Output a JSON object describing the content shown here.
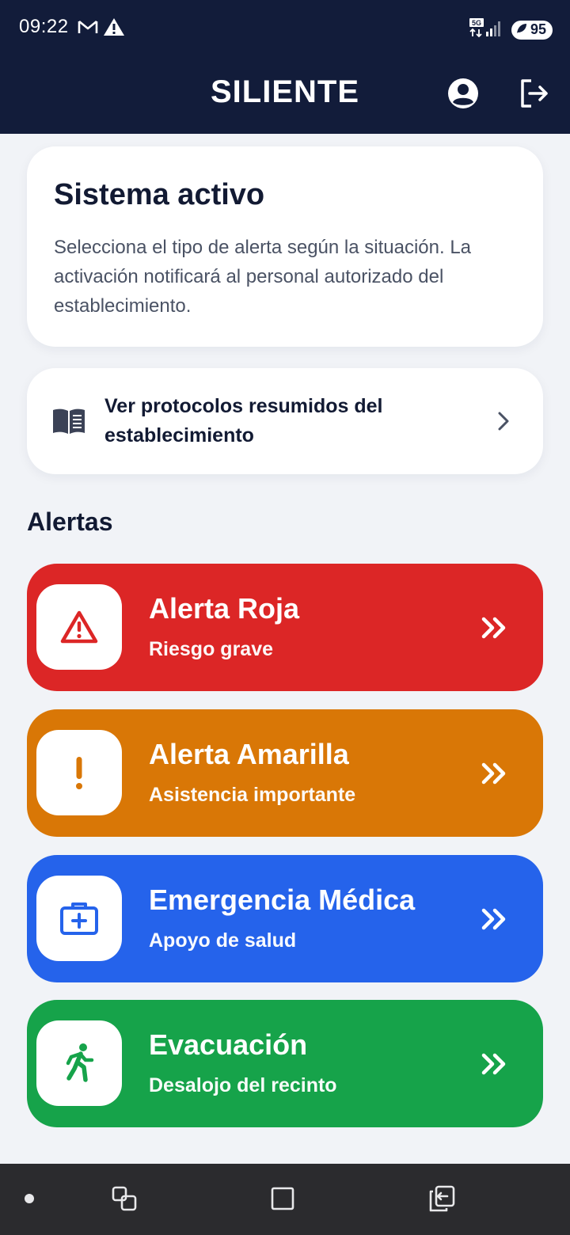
{
  "status_bar": {
    "time": "09:22",
    "left_icons": [
      "gmail-icon",
      "warning-icon"
    ],
    "network": "5G",
    "battery": "95"
  },
  "header": {
    "title": "SILIENTE",
    "profile_icon": "account-circle-icon",
    "logout_icon": "logout-icon"
  },
  "status_card": {
    "title": "Sistema activo",
    "description": "Selecciona el tipo de alerta según la situación. La activación notificará al personal autorizado del establecimiento."
  },
  "protocol_card": {
    "label": "Ver protocolos resumidos del establecimiento",
    "icon": "book-icon"
  },
  "section": {
    "title": "Alertas"
  },
  "alerts": [
    {
      "title": "Alerta Roja",
      "subtitle": "Riesgo grave",
      "color": "#dc2626",
      "icon": "warning-triangle-icon"
    },
    {
      "title": "Alerta Amarilla",
      "subtitle": "Asistencia importante",
      "color": "#d97706",
      "icon": "exclamation-icon"
    },
    {
      "title": "Emergencia Médica",
      "subtitle": "Apoyo de salud",
      "color": "#2563eb",
      "icon": "medical-kit-icon"
    },
    {
      "title": "Evacuación",
      "subtitle": "Desalojo del recinto",
      "color": "#16a34a",
      "icon": "running-person-icon"
    }
  ],
  "nav_bar": {
    "items": [
      "dot-icon",
      "recent-apps-icon",
      "home-square-icon",
      "back-icon"
    ]
  }
}
